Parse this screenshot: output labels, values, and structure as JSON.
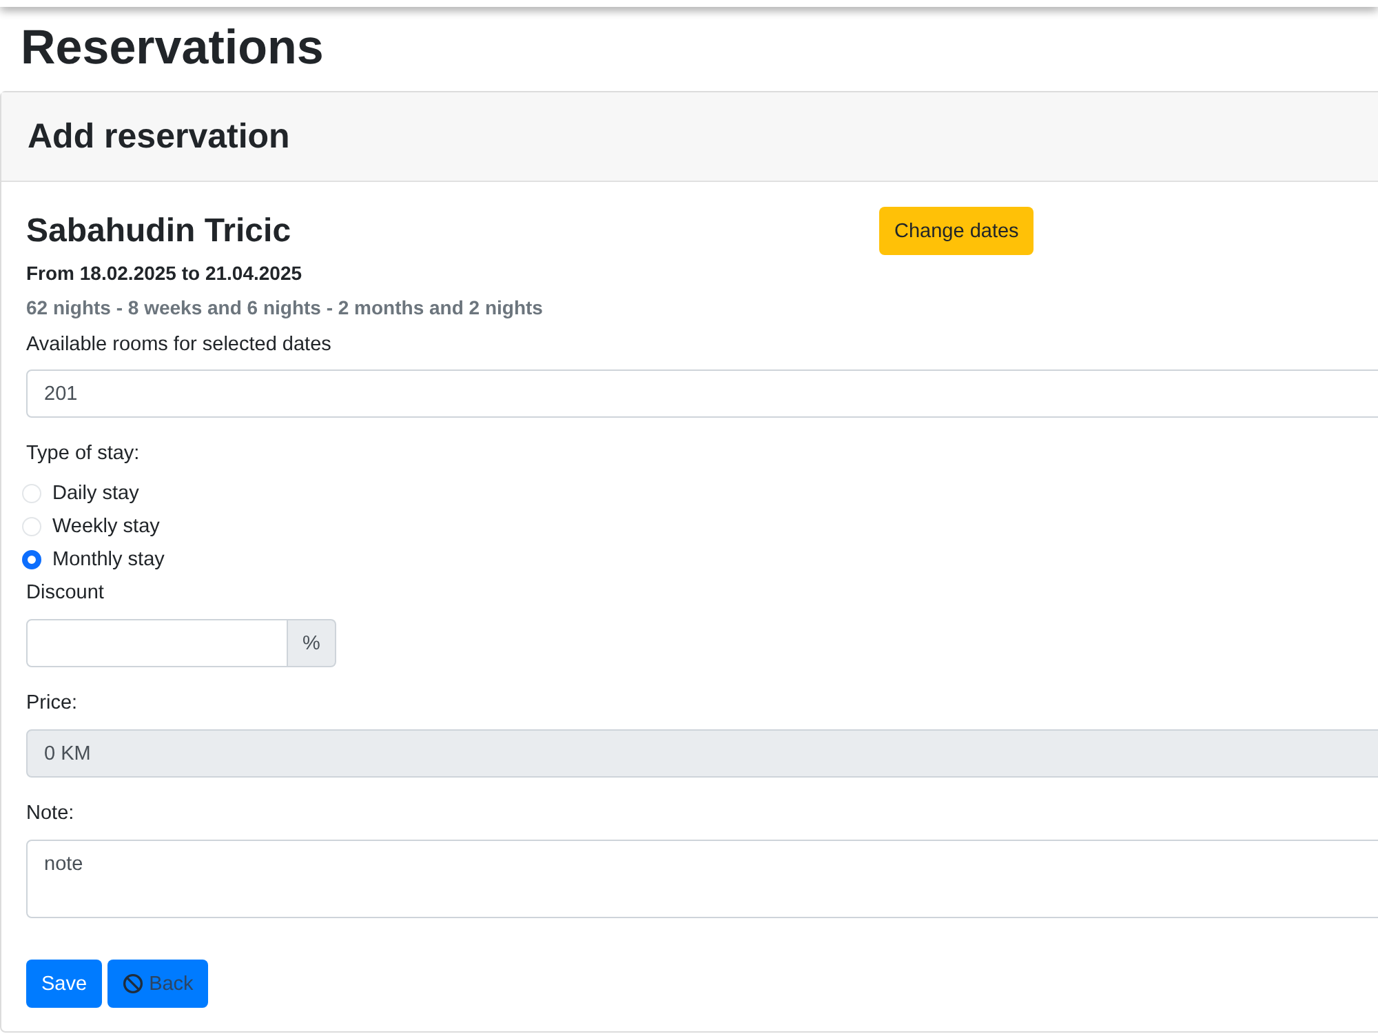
{
  "page": {
    "title": "Reservations"
  },
  "card": {
    "header": "Add reservation",
    "guest_name": "Sabahudin Tricic",
    "change_dates_button": "Change dates",
    "date_range": "From 18.02.2025 to 21.04.2025",
    "duration": "62 nights - 8 weeks and 6 nights - 2 months and 2 nights",
    "room": {
      "label": "Available rooms for selected dates",
      "value": "201"
    },
    "type_of_stay": {
      "label": "Type of stay:",
      "options": [
        {
          "label": "Daily stay",
          "selected": false
        },
        {
          "label": "Weekly stay",
          "selected": false
        },
        {
          "label": "Monthly stay",
          "selected": true
        }
      ]
    },
    "discount": {
      "label": "Discount",
      "addon": "%"
    },
    "price": {
      "label": "Price:",
      "value": "0 KM",
      "disabled": true
    },
    "note": {
      "label": "Note:",
      "value": "note"
    },
    "buttons": [
      {
        "kind": "save",
        "label": "Save"
      },
      {
        "kind": "back",
        "label": "Back"
      }
    ]
  }
}
